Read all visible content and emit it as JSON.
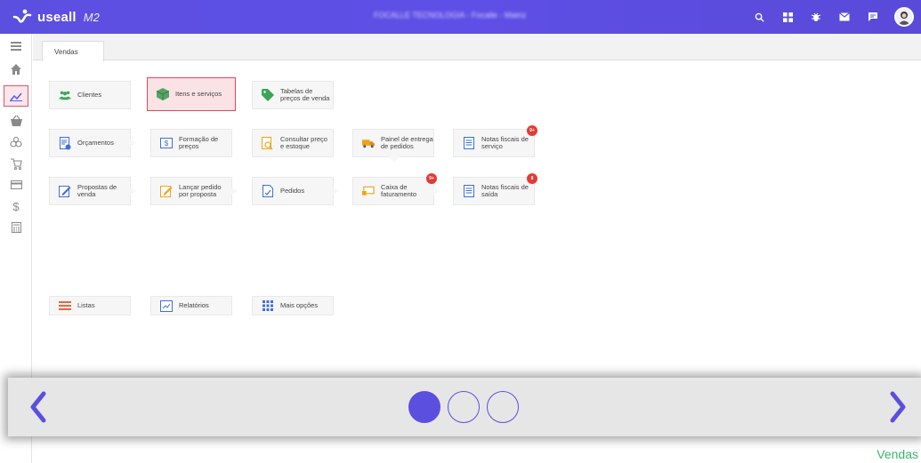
{
  "app": {
    "logo_text": "useall",
    "logo_sub": "M2",
    "company": "FOCALLE TECNOLOGIA - Focalle - Matriz"
  },
  "colors": {
    "brand": "#5b4fe0",
    "badge": "#e53935",
    "selected_border": "#e0485f",
    "footer_text": "#3bb36a"
  },
  "topbar": {
    "icons": [
      "search-icon",
      "grid-icon",
      "bug-icon",
      "mail-icon",
      "chat-icon",
      "avatar"
    ]
  },
  "sidebar": {
    "items": [
      "menu-icon",
      "home-icon",
      "chart-line-icon",
      "basket-icon",
      "boxes-icon",
      "cart-icon",
      "card-icon",
      "dollar-icon",
      "calculator-icon"
    ],
    "active": "chart-line-icon"
  },
  "tabs": [
    {
      "label": "Vendas"
    }
  ],
  "tiles": {
    "clientes": "Clientes",
    "itens": "Itens e serviços",
    "tabelas": "Tabelas de preços de venda",
    "orcamentos": "Orçamentos",
    "formacao": "Formação de preços",
    "consultar": "Consultar preço e estoque",
    "painel": "Painel de entrega de pedidos",
    "nf_servico": "Notas fiscais de serviço",
    "nf_servico_badge": "9+",
    "propostas": "Propostas de venda",
    "lancar": "Lançar pedido por proposta",
    "pedidos": "Pedidos",
    "caixa": "Caixa de faturamento",
    "caixa_badge": "9+",
    "nf_saida": "Notas fiscais de saída",
    "nf_saida_badge": "8",
    "listas": "Listas",
    "relatorios": "Relatórios",
    "mais": "Mais opções"
  },
  "carousel": {
    "pages": 3,
    "active_page": 1
  },
  "footer": {
    "label": "Vendas"
  }
}
